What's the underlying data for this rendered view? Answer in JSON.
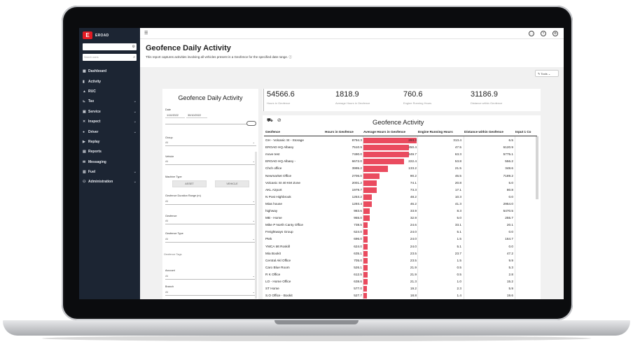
{
  "sidebar": {
    "logo_text": "EROAD",
    "search_placeholder": "Search users",
    "items": [
      {
        "icon": "grid-icon",
        "glyph": "▦",
        "label": "Dashboard",
        "chevron": false
      },
      {
        "icon": "activity-icon",
        "glyph": "▮",
        "label": "Activity",
        "chevron": false
      },
      {
        "icon": "ruc-icon",
        "glyph": "▲",
        "label": "RUC",
        "chevron": false
      },
      {
        "icon": "tax-icon",
        "glyph": "⊾",
        "label": "Tax",
        "chevron": true
      },
      {
        "icon": "service-icon",
        "glyph": "▣",
        "label": "Service",
        "chevron": true
      },
      {
        "icon": "inspect-icon",
        "glyph": "✕",
        "label": "Inspect",
        "chevron": true
      },
      {
        "icon": "driver-icon",
        "glyph": "●",
        "label": "Driver",
        "chevron": true
      },
      {
        "icon": "replay-icon",
        "glyph": "▶",
        "label": "Replay",
        "chevron": false
      },
      {
        "icon": "reports-icon",
        "glyph": "▤",
        "label": "Reports",
        "chevron": false
      },
      {
        "icon": "messaging-icon",
        "glyph": "✉",
        "label": "Messaging",
        "chevron": false
      },
      {
        "icon": "fuel-icon",
        "glyph": "▥",
        "label": "Fuel",
        "chevron": true
      },
      {
        "icon": "admin-icon",
        "glyph": "⚇",
        "label": "Administration",
        "chevron": true
      }
    ]
  },
  "header": {
    "title": "Geofence Daily Activity",
    "description": "This report captures activities involving all vehicles present in a Geofence for the specified date range. ⓘ",
    "tools_label": "Tools ⌄"
  },
  "filters": {
    "title": "Geofence Daily Activity",
    "date_label": "Date",
    "date_from": "1/10/2022",
    "date_to": "30/10/2022",
    "group_label": "Group",
    "group_value": "All",
    "vehicle_label": "Vehicle",
    "vehicle_value": "All",
    "machine_type_label": "Machine Type",
    "seg_asset": "ASSET",
    "seg_vehicle": "VEHICLE",
    "duration_label": "Geofence Duration Range (m)",
    "duration_value": "All",
    "geofence_label": "Geofence",
    "geofence_value": "All",
    "geofence_type_label": "Geofence Type",
    "geofence_type_value": "All",
    "geofence_tags_label": "Geofence Tags",
    "account_label": "Account",
    "account_value": "All",
    "branch_label": "Branch",
    "branch_value": "All"
  },
  "kpis": [
    {
      "value": "54566.6",
      "label": "Hours in Geofence"
    },
    {
      "value": "1818.9",
      "label": "Average Hours in Geofence"
    },
    {
      "value": "760.6",
      "label": "Engine Running Hours"
    },
    {
      "value": "31186.9",
      "label": "Distance within Geofence"
    }
  ],
  "table": {
    "title": "Geofence Activity",
    "headers": {
      "geofence": "Geofence",
      "hours": "Hours in Geofence",
      "avg": "Average Hours in Geofence",
      "engine": "Engine Running Hours",
      "distance": "Distance within Geofence",
      "input": "Input 1 Co"
    },
    "avg_max": 293.3,
    "rows": [
      {
        "geofence": "GH - Volcanic St - Storage",
        "hours": "8794.3",
        "avg": 293.3,
        "avg_text": "293.3",
        "engine": "313.4",
        "distance": "6.5"
      },
      {
        "geofence": "EROAD HQ Albany",
        "hours": "7510.9",
        "avg": 250.4,
        "avg_text": "250.4",
        "engine": "47.5",
        "distance": "6120.9"
      },
      {
        "geofence": "move test",
        "hours": "7490.0",
        "avg": 249.7,
        "avg_text": "249.7",
        "engine": "63.3",
        "distance": "5775.1"
      },
      {
        "geofence": "EROAD HQ Albany -",
        "hours": "6672.0",
        "avg": 222.4,
        "avg_text": "222.4",
        "engine": "53.8",
        "distance": "556.2"
      },
      {
        "geofence": "Chch office",
        "hours": "3995.2",
        "avg": 133.2,
        "avg_text": "133.2",
        "engine": "21.5",
        "distance": "348.6"
      },
      {
        "geofence": "Newmarket Office",
        "hours": "2706.0",
        "avg": 90.2,
        "avg_text": "90.2",
        "engine": "46.5",
        "distance": "7189.2"
      },
      {
        "geofence": "Volcanic St 40 KM Zone",
        "hours": "2001.2",
        "avg": 74.1,
        "avg_text": "74.1",
        "engine": "20.8",
        "distance": "5.0"
      },
      {
        "geofence": "AKL Airport",
        "hours": "1979.7",
        "avg": 73.3,
        "avg_text": "73.3",
        "engine": "17.1",
        "distance": "80.8"
      },
      {
        "geofence": "N Post Highbrook",
        "hours": "1253.2",
        "avg": 48.2,
        "avg_text": "48.2",
        "engine": "10.3",
        "distance": "0.0"
      },
      {
        "geofence": "Mias house",
        "hours": "1293.4",
        "avg": 46.2,
        "avg_text": "46.2",
        "engine": "41.3",
        "distance": "2954.0"
      },
      {
        "geofence": "highway",
        "hours": "983.6",
        "avg": 33.9,
        "avg_text": "33.9",
        "engine": "8.3",
        "distance": "5470.5"
      },
      {
        "geofence": "MB - Home",
        "hours": "955.0",
        "avg": 32.9,
        "avg_text": "32.9",
        "engine": "5.0",
        "distance": "255.7"
      },
      {
        "geofence": "Mike P North Canty Office",
        "hours": "738.5",
        "avg": 24.6,
        "avg_text": "24.6",
        "engine": "33.1",
        "distance": "20.1"
      },
      {
        "geofence": "Freightways Group",
        "hours": "624.0",
        "avg": 24.0,
        "avg_text": "24.0",
        "engine": "5.1",
        "distance": "0.0"
      },
      {
        "geofence": "Ptek",
        "hours": "696.0",
        "avg": 24.0,
        "avg_text": "24.0",
        "engine": "1.5",
        "distance": "164.7"
      },
      {
        "geofence": "YMCA Mt Roskill",
        "hours": "624.0",
        "avg": 24.0,
        "avg_text": "24.0",
        "engine": "5.1",
        "distance": "0.0"
      },
      {
        "geofence": "Mia Bookit",
        "hours": "635.1",
        "avg": 23.5,
        "avg_text": "23.5",
        "engine": "23.7",
        "distance": "47.2"
      },
      {
        "geofence": "Central Akl Office",
        "hours": "705.0",
        "avg": 23.5,
        "avg_text": "23.5",
        "engine": "1.5",
        "distance": "9.9"
      },
      {
        "geofence": "Caro Blue Room",
        "hours": "526.1",
        "avg": 21.9,
        "avg_text": "21.9",
        "engine": "0.5",
        "distance": "5.3"
      },
      {
        "geofence": "R K Office",
        "hours": "612.5",
        "avg": 21.9,
        "avg_text": "21.9",
        "engine": "0.5",
        "distance": "2.8"
      },
      {
        "geofence": "LO - Home Office",
        "hours": "638.6",
        "avg": 21.3,
        "avg_text": "21.3",
        "engine": "1.0",
        "distance": "15.2"
      },
      {
        "geofence": "ST Home",
        "hours": "577.0",
        "avg": 19.2,
        "avg_text": "19.2",
        "engine": "2.3",
        "distance": "5.9"
      },
      {
        "geofence": "S.O Office - Bookit",
        "hours": "527.7",
        "avg": 18.8,
        "avg_text": "18.8",
        "engine": "1.4",
        "distance": "19.6"
      }
    ]
  }
}
